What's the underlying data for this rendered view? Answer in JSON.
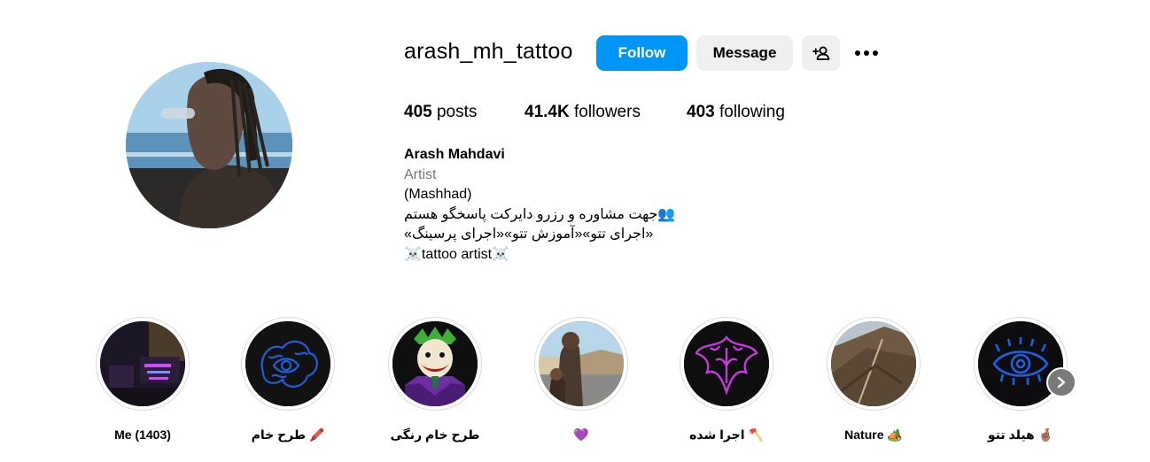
{
  "profile": {
    "username": "arash_mh_tattoo",
    "follow_label": "Follow",
    "message_label": "Message",
    "stats": {
      "posts_count": "405",
      "posts_label": " posts",
      "followers_count": "41.4K",
      "followers_label": " followers",
      "following_count": "403",
      "following_label": " following"
    },
    "bio": {
      "full_name": "Arash Mahdavi",
      "category": "Artist",
      "lines": [
        "(Mashhad)",
        "👥جهت مشاوره و رزرو دایرکت پاسخگو هستم",
        "«اجرای تتو»«آموزش تتو»«اجرای پرسینگ»",
        "☠️tattoo artist☠️"
      ]
    }
  },
  "highlights": [
    {
      "label": "Me (1403)"
    },
    {
      "label": "طرح خام 🖍️"
    },
    {
      "label": "طرح خام رنگی"
    },
    {
      "label": "💜"
    },
    {
      "label": "اجرا شده 🪓"
    },
    {
      "label": "Nature 🏕️"
    },
    {
      "label": "هیلد تتو 🤞🏽"
    }
  ],
  "colors": {
    "accent": "#0095f6",
    "secondary_button": "#efefef",
    "muted_text": "#737373"
  },
  "icons": {
    "suggest": "add-person-icon",
    "more": "more-horizontal-icon",
    "next": "chevron-right-icon"
  }
}
